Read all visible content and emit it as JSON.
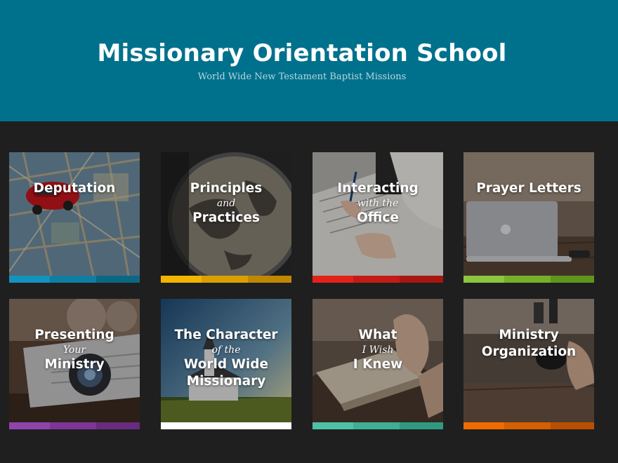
{
  "header": {
    "title": "Missionary Orientation School",
    "subtitle": "World Wide New Testament Baptist Missions"
  },
  "tiles": [
    {
      "lines": [
        {
          "text": "Deputation"
        }
      ],
      "image": "map-with-toy-car-image",
      "colors": [
        "#1592bd",
        "#0f7ea3",
        "#0b6884"
      ]
    },
    {
      "lines": [
        {
          "text": "Principles"
        },
        {
          "text": "and"
        },
        {
          "text": "Practices"
        }
      ],
      "image": "globe-image",
      "colors": [
        "#f2b400",
        "#dc9f00",
        "#c08800"
      ]
    },
    {
      "lines": [
        {
          "text": "Interacting"
        },
        {
          "text": "with the"
        },
        {
          "text": "Office"
        }
      ],
      "image": "office-desk-writing-image",
      "colors": [
        "#e3231a",
        "#c41b14",
        "#a8160f"
      ]
    },
    {
      "lines": [
        {
          "text": "Prayer Letters"
        }
      ],
      "image": "laptop-image",
      "colors": [
        "#8cc63f",
        "#76b02b",
        "#5e961c"
      ]
    },
    {
      "lines": [
        {
          "text": "Presenting"
        },
        {
          "text": "Your"
        },
        {
          "text": "Ministry"
        }
      ],
      "image": "projector-image",
      "colors": [
        "#8e44ad",
        "#7b3697",
        "#672b80"
      ]
    },
    {
      "lines": [
        {
          "text": "The Character"
        },
        {
          "text": "of the"
        },
        {
          "text": "World Wide"
        },
        {
          "text": "Missionary"
        }
      ],
      "image": "country-church-image",
      "colors": [
        "#ffffff",
        "#ffffff",
        "#ffffff"
      ]
    },
    {
      "lines": [
        {
          "text": "What"
        },
        {
          "text": "I Wish"
        },
        {
          "text": "I Knew"
        }
      ],
      "image": "praying-hands-bible-image",
      "colors": [
        "#4fc1a6",
        "#3fae94",
        "#2f9a81"
      ]
    },
    {
      "lines": [
        {
          "text": "Ministry"
        },
        {
          "text": "Organization"
        }
      ],
      "image": "desk-organizer-image",
      "colors": [
        "#f06c00",
        "#d65f00",
        "#b94f00"
      ]
    }
  ]
}
